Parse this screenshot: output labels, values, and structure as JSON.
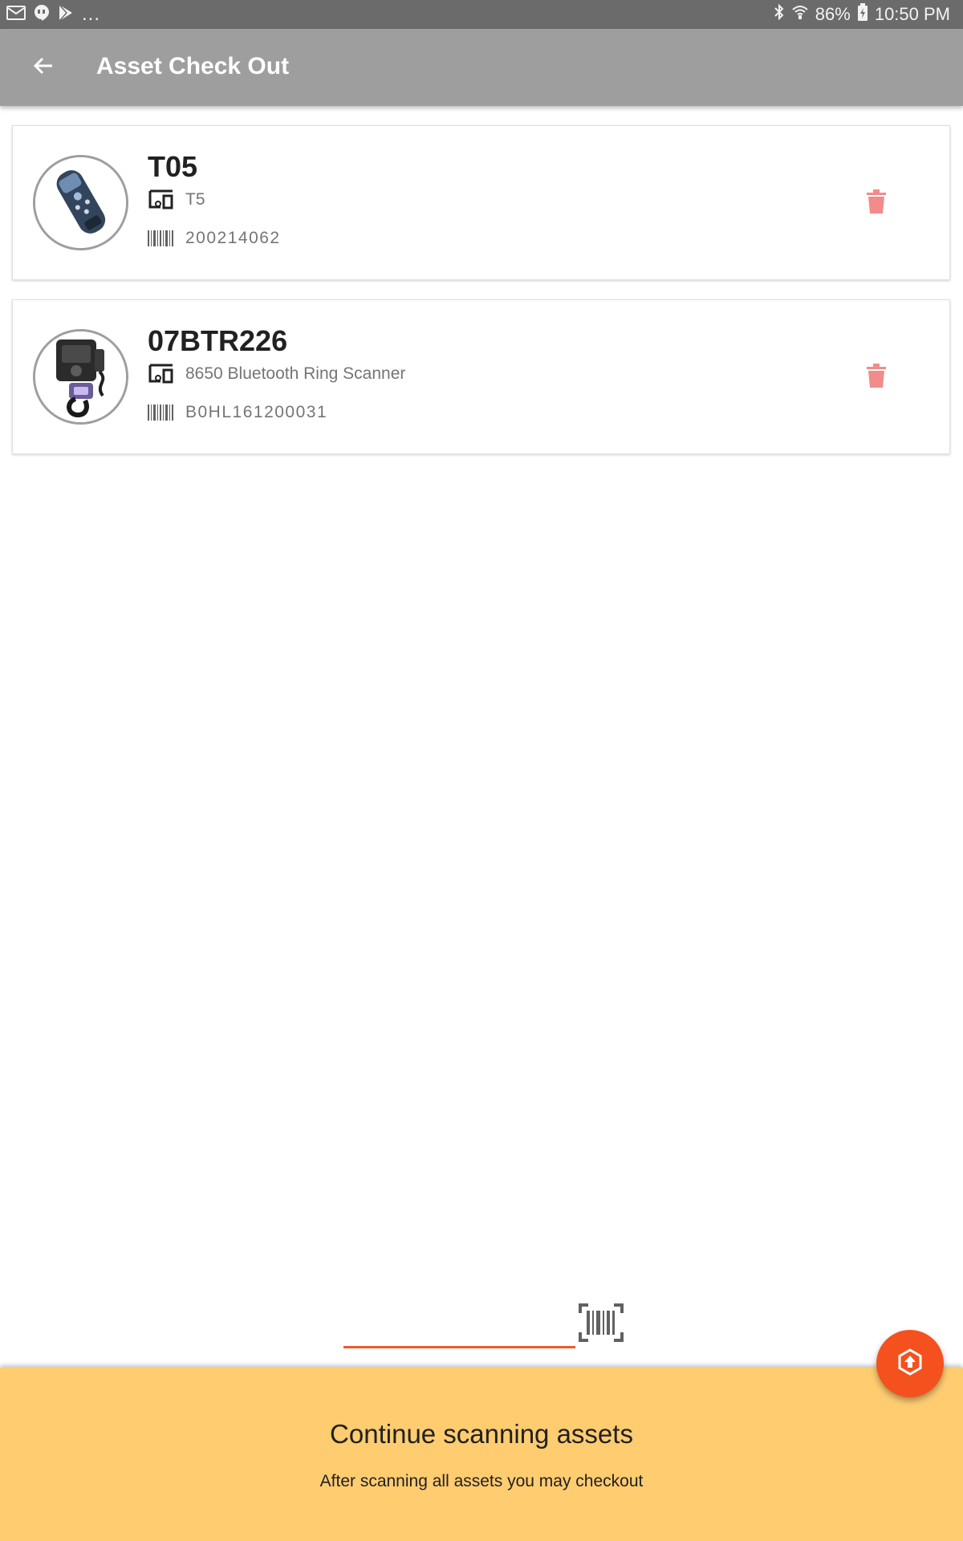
{
  "status_bar": {
    "overflow": "...",
    "battery": "86%",
    "time": "10:50 PM",
    "left_icons": [
      "gmail-icon",
      "hangouts-icon",
      "play-store-icon"
    ],
    "right_icons": [
      "bluetooth-icon",
      "wifi-icon",
      "battery-charging-icon"
    ]
  },
  "app_bar": {
    "title": "Asset Check Out",
    "back_icon": "arrow-left-icon"
  },
  "assets": [
    {
      "name": "T05",
      "model": "T5",
      "serial": "200214062",
      "image": "handheld-scanner-photo",
      "delete_icon": "trash-icon"
    },
    {
      "name": "07BTR226",
      "model": "8650 Bluetooth Ring Scanner",
      "serial": "B0HL161200031",
      "image": "ring-scanner-photo",
      "delete_icon": "trash-icon"
    }
  ],
  "scan": {
    "value": "",
    "icon": "barcode-scan-icon"
  },
  "bottom_panel": {
    "heading": "Continue scanning assets",
    "subtext": "After scanning all assets you may checkout"
  },
  "fab": {
    "icon": "checkout-upload-icon"
  },
  "colors": {
    "status_bar": "#6b6b6b",
    "app_bar": "#9e9e9e",
    "accent": "#f4511e",
    "input_underline": "#f0592d",
    "delete": "#f28b8b",
    "panel": "#ffcc70",
    "title_text": "#212121",
    "secondary_text": "#757575"
  }
}
